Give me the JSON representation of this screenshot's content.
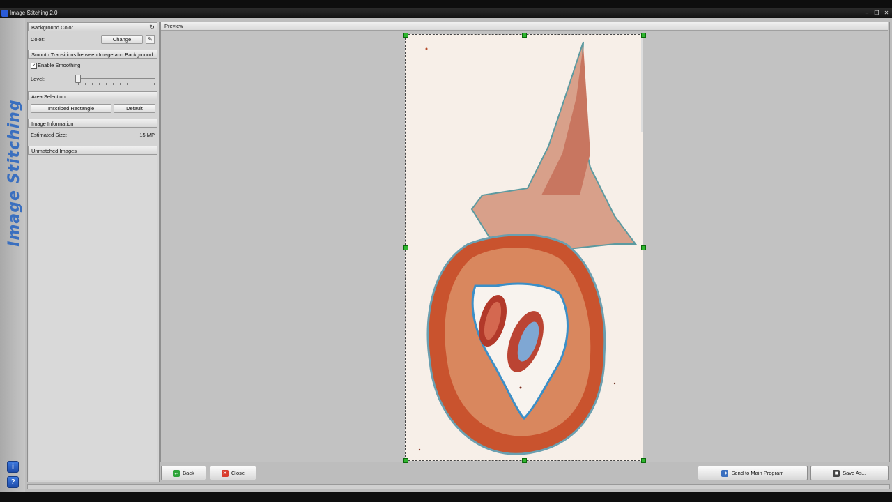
{
  "window": {
    "title": "Image Stitching 2.0"
  },
  "brand": {
    "text": "Image Stitching"
  },
  "side_icons": {
    "info": "i",
    "help": "?"
  },
  "background_color": {
    "header": "Background Color",
    "color_label": "Color:",
    "change_button": "Change"
  },
  "smoothing": {
    "header": "Smooth Transitions between Image and Background",
    "enable_label": "Enable Smoothing",
    "enabled": true,
    "level_label": "Level:",
    "level_value": 0
  },
  "area_selection": {
    "header": "Area Selection",
    "inscribed_button": "Inscribed Rectangle",
    "default_button": "Default"
  },
  "image_info": {
    "header": "Image Information",
    "size_label": "Estimated Size:",
    "size_value": "15 MP"
  },
  "unmatched": {
    "header": "Unmatched Images"
  },
  "preview": {
    "header": "Preview"
  },
  "bottom": {
    "back_button": "Back",
    "close_button": "Close",
    "send_button": "Send to Main Program",
    "save_button": "Save As..."
  },
  "colors": {
    "accent": "#3a6fbf",
    "handle": "#2fb52f"
  }
}
